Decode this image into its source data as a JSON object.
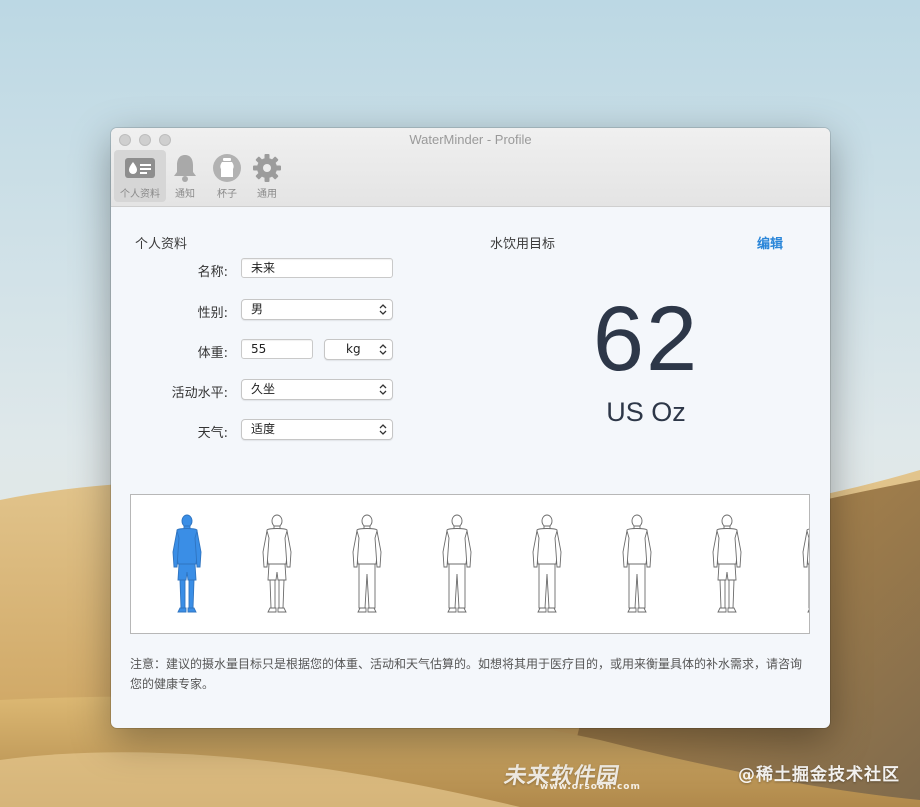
{
  "window": {
    "title": "WaterMinder - Profile"
  },
  "toolbar": {
    "items": [
      {
        "label": "个人资料",
        "icon": "profile-card-icon",
        "selected": true
      },
      {
        "label": "通知",
        "icon": "bell-icon",
        "selected": false
      },
      {
        "label": "杯子",
        "icon": "cup-icon",
        "selected": false
      },
      {
        "label": "通用",
        "icon": "gear-icon",
        "selected": false
      }
    ]
  },
  "profile": {
    "section_title": "个人资料",
    "name_label": "名称:",
    "name_value": "未来",
    "gender_label": "性别:",
    "gender_value": "男",
    "weight_label": "体重:",
    "weight_value": "55",
    "weight_unit": "kg",
    "activity_label": "活动水平:",
    "activity_value": "久坐",
    "weather_label": "天气:",
    "weather_value": "适度"
  },
  "goal": {
    "section_title": "水饮用目标",
    "edit_label": "编辑",
    "value": "62",
    "unit": "US Oz"
  },
  "figures": {
    "selected_index": 0,
    "count": 8,
    "selected_color": "#3a8ee6"
  },
  "disclaimer": "注意：建议的摄水量目标只是根据您的体重、活动和天气估算的。如想将其用于医疗目的，或用来衡量具体的补水需求，请咨询您的健康专家。",
  "watermarks": {
    "bottom_center": "未来软件园",
    "bottom_center_sub": "www.orsoon.com",
    "bottom_right": "@稀土掘金技术社区"
  },
  "colors": {
    "accent": "#2a86d9",
    "goal_text": "#2d3748"
  }
}
